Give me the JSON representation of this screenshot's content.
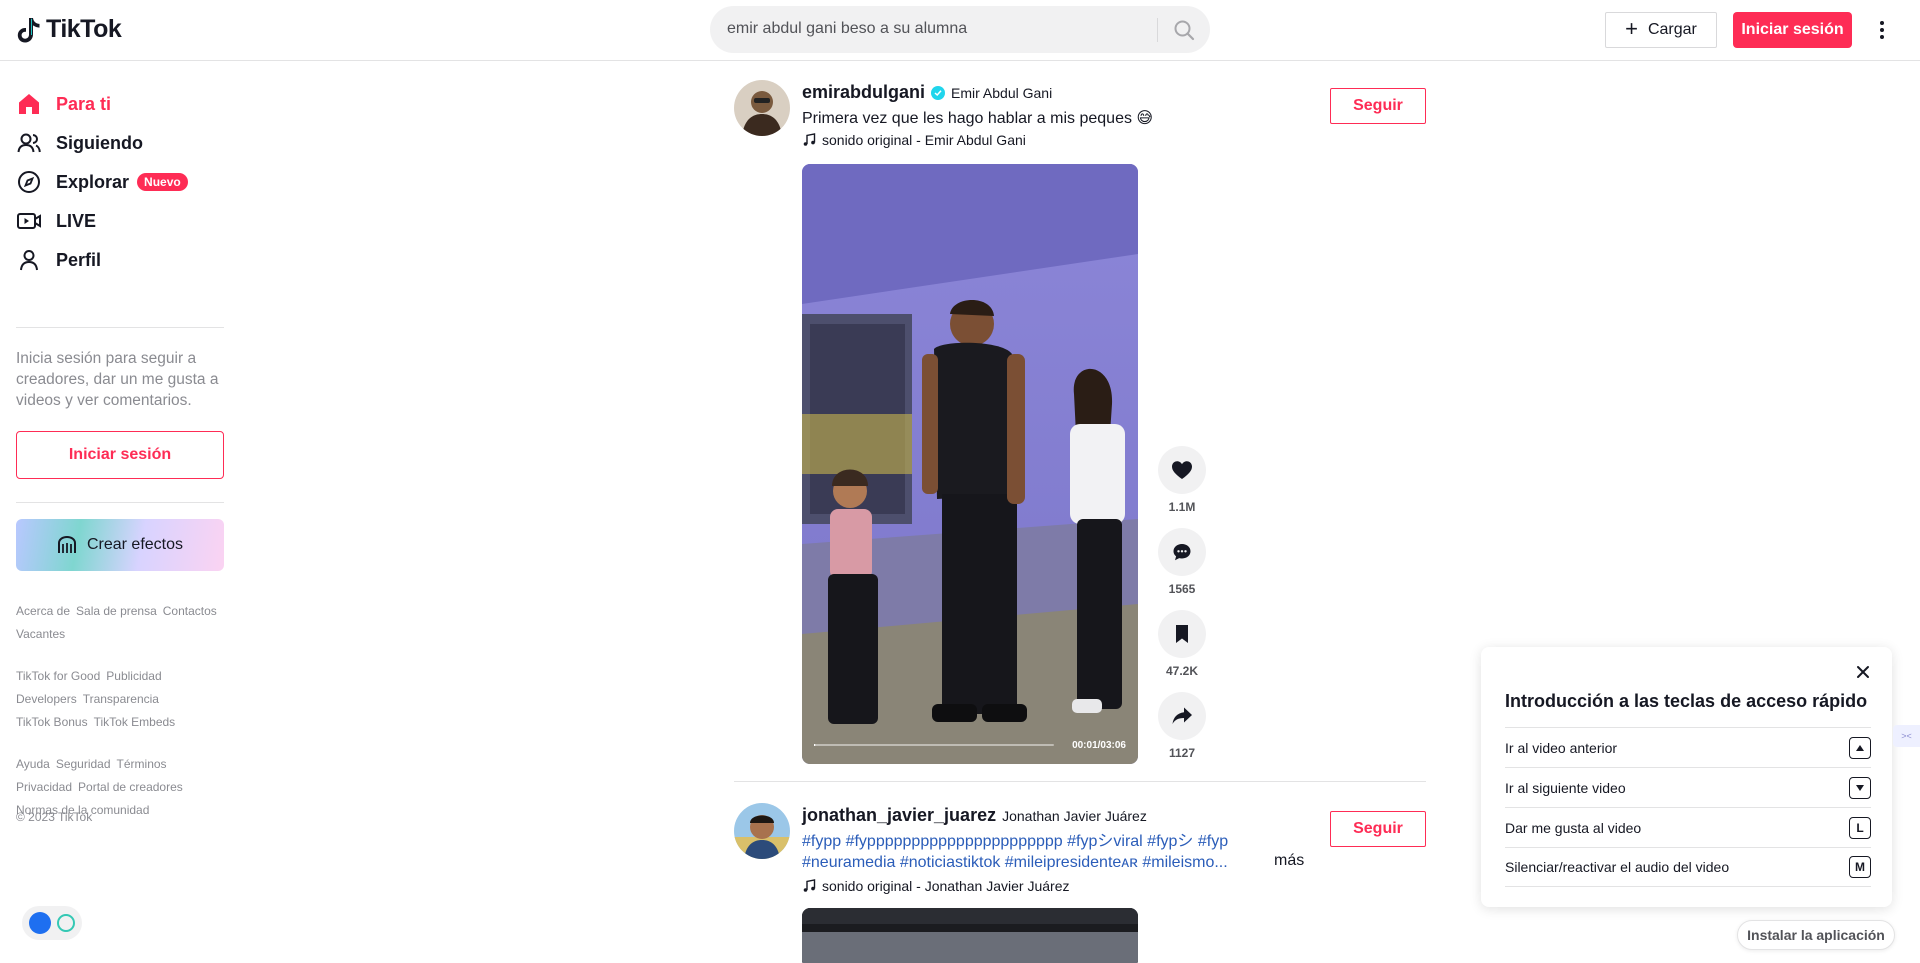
{
  "header": {
    "logo_text": "TikTok",
    "search_query": "emir abdul gani beso a su alumna",
    "upload_label": "Cargar",
    "login_label": "Iniciar sesión"
  },
  "sidebar": {
    "nav": [
      {
        "label": "Para ti",
        "icon": "home-icon",
        "active": true
      },
      {
        "label": "Siguiendo",
        "icon": "people-icon"
      },
      {
        "label": "Explorar",
        "icon": "compass-icon",
        "badge": "Nuevo"
      },
      {
        "label": "LIVE",
        "icon": "live-icon"
      },
      {
        "label": "Perfil",
        "icon": "person-icon"
      }
    ],
    "login_hint": "Inicia sesión para seguir a creadores, dar un me gusta a videos y ver comentarios.",
    "login_button": "Iniciar sesión",
    "effects_label": "Crear efectos",
    "footer_groups": [
      [
        "Acerca de",
        "Sala de prensa",
        "Contactos",
        "Vacantes"
      ],
      [
        "TikTok for Good",
        "Publicidad",
        "Developers",
        "Transparencia",
        "TikTok Bonus",
        "TikTok Embeds"
      ],
      [
        "Ayuda",
        "Seguridad",
        "Términos",
        "Privacidad",
        "Portal de creadores",
        "Normas de la comunidad"
      ]
    ],
    "copyright": "© 2023 TikTok"
  },
  "posts": [
    {
      "username": "emirabdulgani",
      "verified": true,
      "nickname": "Emir Abdul Gani",
      "caption": "Primera vez que les hago hablar a mis peques 😅",
      "music": "sonido original - Emir Abdul Gani",
      "follow_label": "Seguir",
      "video_time": "00:01/03:06",
      "progress": 0.005,
      "likes": "1.1M",
      "comments": "1565",
      "saves": "47.2K",
      "shares": "1127"
    },
    {
      "username": "jonathan_javier_juarez",
      "nickname": "Jonathan Javier Juárez",
      "tags_line1": "#fypp #fypppppppppppppppppppppp #fypシviral #fypシ #fyp",
      "tags_line2": "#neuramedia #noticiastiktok #mileipresidenteᴀʀ #mileismo...",
      "more_label": "más",
      "music": "sonido original - Jonathan Javier Juárez",
      "follow_label": "Seguir"
    }
  ],
  "shortcuts": {
    "title": "Introducción a las teclas de acceso rápido",
    "items": [
      {
        "label": "Ir al video anterior",
        "key": "▲"
      },
      {
        "label": "Ir al siguiente video",
        "key": "▼"
      },
      {
        "label": "Dar me gusta al video",
        "key": "L"
      },
      {
        "label": "Silenciar/reactivar el audio del video",
        "key": "M"
      }
    ]
  },
  "install_label": "Instalar la aplicación",
  "colors": {
    "brand": "#fe2c55",
    "hashtag": "#2b5db9",
    "verified": "#20d5ec"
  }
}
